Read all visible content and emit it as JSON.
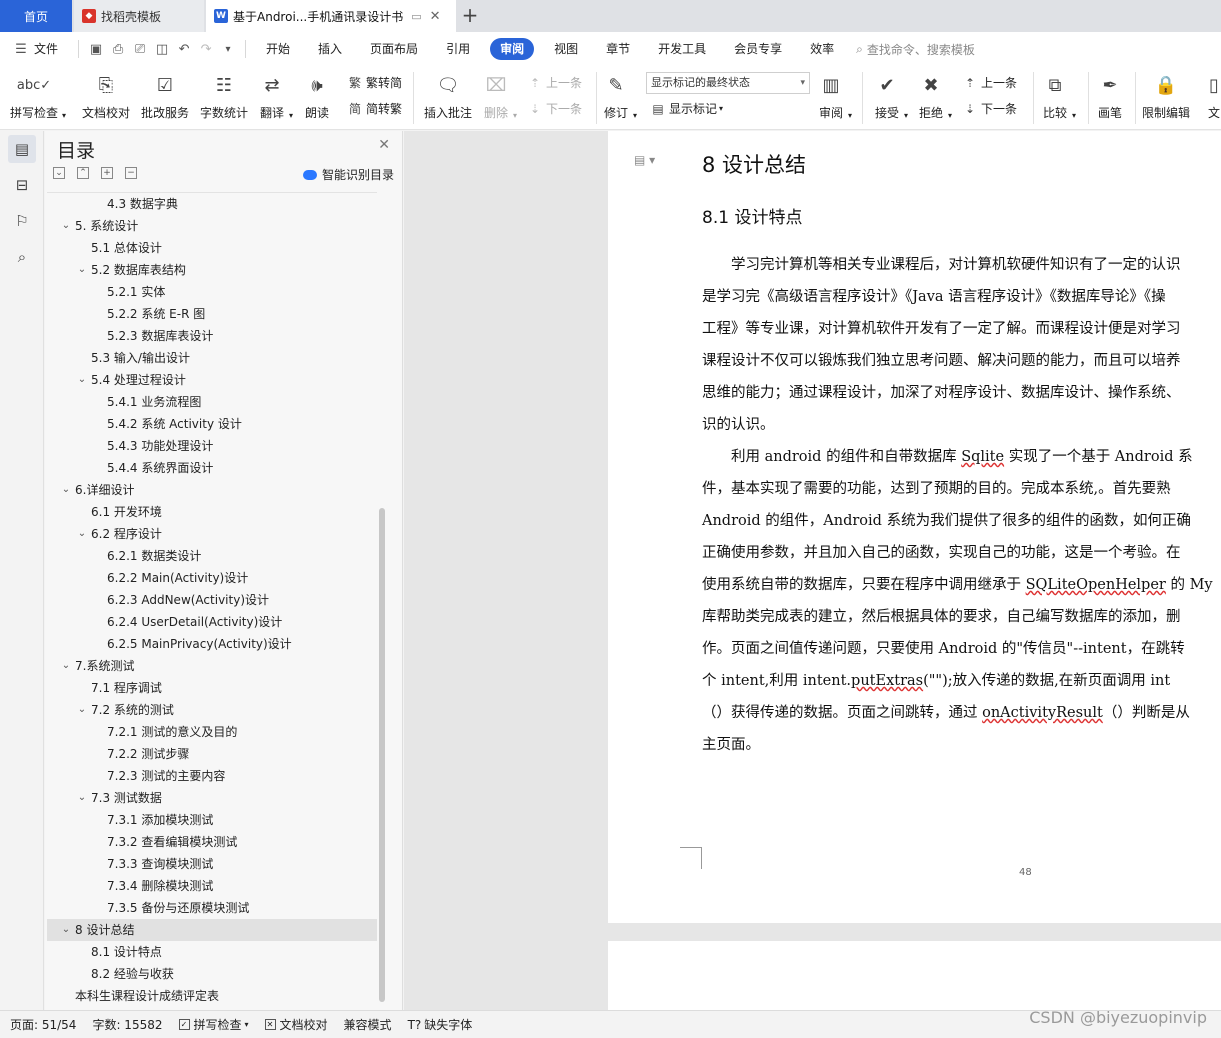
{
  "tabs": {
    "home": "首页",
    "template": "找稻壳模板",
    "doc": "基于Androi...手机通讯录设计书"
  },
  "menu": {
    "file": "文件",
    "items": [
      "开始",
      "插入",
      "页面布局",
      "引用",
      "审阅",
      "视图",
      "章节",
      "开发工具",
      "会员专享",
      "效率"
    ],
    "active": "审阅",
    "search": "查找命令、搜索模板"
  },
  "ribbon": {
    "spell_check": "拼写检查",
    "doc_proof": "文档校对",
    "batch_service": "批改服务",
    "word_count": "字数统计",
    "translate": "翻译",
    "read_aloud": "朗读",
    "to_traditional": "繁转简",
    "to_simplified": "简转繁",
    "insert_comment": "插入批注",
    "delete": "删除",
    "prev": "上一条",
    "next": "下一条",
    "revise": "修订",
    "markup_state": "显示标记的最终状态",
    "show_markup": "显示标记",
    "review": "审阅",
    "accept": "接受",
    "reject": "拒绝",
    "prev2": "上一条",
    "next2": "下一条",
    "compare": "比较",
    "pen": "画笔",
    "restrict_edit": "限制编辑",
    "doc_partial": "文"
  },
  "toc": {
    "title": "目录",
    "smart": "智能识别目录",
    "items": [
      {
        "level": 3,
        "text": "4.3  数据字典",
        "caret": ""
      },
      {
        "level": 1,
        "text": "5.  系统设计",
        "caret": "v"
      },
      {
        "level": 2,
        "text": "5.1  总体设计",
        "caret": ""
      },
      {
        "level": 2,
        "text": "5.2  数据库表结构",
        "caret": "v"
      },
      {
        "level": 3,
        "text": "5.2.1  实体",
        "caret": ""
      },
      {
        "level": 3,
        "text": "5.2.2  系统 E-R 图",
        "caret": ""
      },
      {
        "level": 3,
        "text": "5.2.3  数据库表设计",
        "caret": ""
      },
      {
        "level": 2,
        "text": "5.3  输入/输出设计",
        "caret": ""
      },
      {
        "level": 2,
        "text": "5.4  处理过程设计",
        "caret": "v"
      },
      {
        "level": 3,
        "text": "5.4.1  业务流程图",
        "caret": ""
      },
      {
        "level": 3,
        "text": "5.4.2  系统 Activity 设计",
        "caret": ""
      },
      {
        "level": 3,
        "text": "5.4.3  功能处理设计",
        "caret": ""
      },
      {
        "level": 3,
        "text": "5.4.4  系统界面设计",
        "caret": ""
      },
      {
        "level": 1,
        "text": "6.详细设计",
        "caret": "v"
      },
      {
        "level": 2,
        "text": "6.1  开发环境",
        "caret": ""
      },
      {
        "level": 2,
        "text": "6.2  程序设计",
        "caret": "v"
      },
      {
        "level": 3,
        "text": "6.2.1  数据类设计",
        "caret": ""
      },
      {
        "level": 3,
        "text": "6.2.2 Main(Activity)设计",
        "caret": ""
      },
      {
        "level": 3,
        "text": "6.2.3 AddNew(Activity)设计",
        "caret": ""
      },
      {
        "level": 3,
        "text": "6.2.4 UserDetail(Activity)设计",
        "caret": ""
      },
      {
        "level": 3,
        "text": "6.2.5 MainPrivacy(Activity)设计",
        "caret": ""
      },
      {
        "level": 1,
        "text": "7.系统测试",
        "caret": "v"
      },
      {
        "level": 2,
        "text": "7.1  程序调试",
        "caret": ""
      },
      {
        "level": 2,
        "text": "7.2  系统的测试",
        "caret": "v"
      },
      {
        "level": 3,
        "text": "7.2.1  测试的意义及目的",
        "caret": ""
      },
      {
        "level": 3,
        "text": "7.2.2  测试步骤",
        "caret": ""
      },
      {
        "level": 3,
        "text": "7.2.3  测试的主要内容",
        "caret": ""
      },
      {
        "level": 2,
        "text": "7.3  测试数据",
        "caret": "v"
      },
      {
        "level": 3,
        "text": "7.3.1  添加模块测试",
        "caret": ""
      },
      {
        "level": 3,
        "text": "7.3.2  查看编辑模块测试",
        "caret": ""
      },
      {
        "level": 3,
        "text": "7.3.3  查询模块测试",
        "caret": ""
      },
      {
        "level": 3,
        "text": "7.3.4  删除模块测试",
        "caret": ""
      },
      {
        "level": 3,
        "text": "7.3.5  备份与还原模块测试",
        "caret": ""
      },
      {
        "level": 1,
        "text": "8 设计总结",
        "caret": "v",
        "selected": true
      },
      {
        "level": 2,
        "text": "8.1  设计特点",
        "caret": ""
      },
      {
        "level": 2,
        "text": "8.2  经验与收获",
        "caret": ""
      },
      {
        "level": 1,
        "text": "本科生课程设计成绩评定表",
        "caret": ""
      }
    ]
  },
  "document": {
    "heading1": "8 设计总结",
    "heading2": "8.1  设计特点",
    "lines": [
      [
        {
          "t": "　　学习完计算机等相关专业课程后，对计算机软硬件知识有了一定的认识"
        }
      ],
      [
        {
          "t": "是学习完《高级语言程序设计》《Java 语言程序设计》《数据库导论》《操"
        }
      ],
      [
        {
          "t": "工程》等专业课，对计算机软件开发有了一定了解。而课程设计便是对学习"
        }
      ],
      [
        {
          "t": "课程设计不仅可以锻炼我们独立思考问题、解决问题的能力，而且可以培养"
        }
      ],
      [
        {
          "t": "思维的能力；通过课程设计，加深了对程序设计、数据库设计、操作系统、"
        }
      ],
      [
        {
          "t": "识的认识。"
        }
      ],
      [
        {
          "t": "　　利用 android 的组件和自带数据库 "
        },
        {
          "t": "Sqlite",
          "u": true
        },
        {
          "t": " 实现了一个基于 Android 系"
        }
      ],
      [
        {
          "t": "件，基本实现了需要的功能，达到了预期的目的。完成本系统,。首先要熟"
        }
      ],
      [
        {
          "t": "Android 的组件，Android 系统为我们提供了很多的组件的函数，如何正确"
        }
      ],
      [
        {
          "t": "正确使用参数，并且加入自己的函数，实现自己的功能，这是一个考验。在"
        }
      ],
      [
        {
          "t": "使用系统自带的数据库，只要在程序中调用继承于 "
        },
        {
          "t": "SQLiteOpenHelper",
          "u": true
        },
        {
          "t": " 的 My"
        }
      ],
      [
        {
          "t": "库帮助类完成表的建立，然后根据具体的要求，自己编写数据库的添加，删"
        }
      ],
      [
        {
          "t": "作。页面之间值传递问题，只要使用 Android 的\"传信员\"--intent，在跳转"
        }
      ],
      [
        {
          "t": "个 intent,利用 intent."
        },
        {
          "t": "putExtras",
          "u": true
        },
        {
          "t": "(\"\");放入传递的数据,在新页面调用 int"
        }
      ],
      [
        {
          "t": "（）获得传递的数据。页面之间跳转，通过 "
        },
        {
          "t": "onActivityResult",
          "u": true
        },
        {
          "t": "（）判断是从"
        }
      ],
      [
        {
          "t": "主页面。"
        }
      ]
    ],
    "page_number": "48"
  },
  "status": {
    "page": "页面: 51/54",
    "words": "字数: 15582",
    "spell": "拼写检查",
    "proof": "文档校对",
    "compat": "兼容模式",
    "missing_font": "缺失字体"
  },
  "watermark": "CSDN @biyezuopinvip",
  "colors": {
    "accent": "#2a64d8",
    "spell_underline": "#dd3333"
  }
}
